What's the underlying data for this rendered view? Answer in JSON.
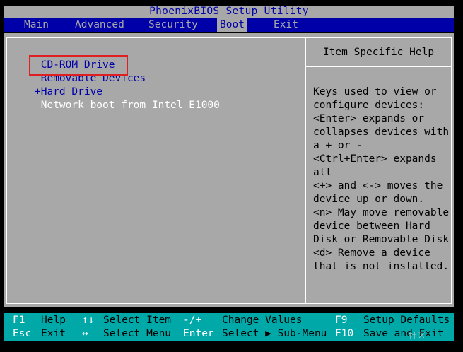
{
  "title": "PhoenixBIOS Setup Utility",
  "menu": [
    {
      "label": "Main"
    },
    {
      "label": "Advanced"
    },
    {
      "label": "Security"
    },
    {
      "label": "Boot",
      "active": true
    },
    {
      "label": "Exit"
    }
  ],
  "boot_order": [
    {
      "label": " CD-ROM Drive",
      "selected": true
    },
    {
      "label": " Removable Devices"
    },
    {
      "label": "+Hard Drive"
    },
    {
      "label": " Network boot from Intel E1000",
      "disabled": true
    }
  ],
  "help": {
    "title": "Item Specific Help",
    "text": "Keys used to view or\nconfigure devices:\n<Enter> expands or\ncollapses devices with\na + or -\n<Ctrl+Enter> expands\nall\n<+> and <-> moves the\ndevice up or down.\n<n> May move removable\ndevice between Hard\nDisk or Removable Disk\n<d> Remove a device\nthat is not installed."
  },
  "footer": {
    "row1": [
      {
        "key": "F1",
        "label": "Help"
      },
      {
        "key": "↑↓",
        "label": "Select Item"
      },
      {
        "key": "-/+",
        "label": "Change Values"
      },
      {
        "key": "F9",
        "label": "Setup Defaults"
      }
    ],
    "row2": [
      {
        "key": "Esc",
        "label": "Exit"
      },
      {
        "key": "↔",
        "label": "Select Menu"
      },
      {
        "key": "Enter",
        "label": "Select ▶ Sub-Menu"
      },
      {
        "key": "F10",
        "label": "Save and Exit"
      }
    ]
  },
  "watermark": "社区",
  "colors": {
    "bios_blue": "#0000a8",
    "bios_gray": "#a8a8a8",
    "footer_cyan": "#00a8a8",
    "highlight_red": "#e02020"
  }
}
